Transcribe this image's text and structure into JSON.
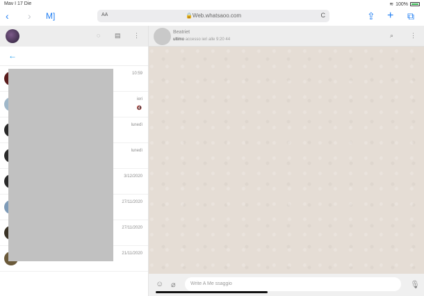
{
  "status_bar": {
    "time": "Mav I 17 Die",
    "battery_text": "100%",
    "wifi_icon": "wifi-icon"
  },
  "browser": {
    "back_icon": "‹",
    "forward_icon": "›",
    "bookmarks_icon": "M]",
    "aa_label": "AA",
    "url": "Web.whatsaoo.com",
    "reload_icon": "C",
    "share_icon": "⇪",
    "new_tab_icon": "+",
    "tabs_icon": "⧉"
  },
  "sidebar": {
    "back_arrow": "←",
    "chats": [
      {
        "time": "10:59",
        "snippet": "",
        "mute": ""
      },
      {
        "time": "ieri",
        "snippet": "",
        "mute": "🔇"
      },
      {
        "time": "lunedì",
        "snippet": "",
        "mute": ""
      },
      {
        "time": "lunedì",
        "snippet": "",
        "mute": ""
      },
      {
        "time": "3/12/2020",
        "snippet": "",
        "mute": ""
      },
      {
        "time": "27/11/2020",
        "snippet": "",
        "mute": ""
      },
      {
        "time": "27/11/2020",
        "snippet": "",
        "mute": ""
      },
      {
        "time": "21/11/2020",
        "snippet": "",
        "mute": ""
      }
    ]
  },
  "conversation": {
    "contact_name": "Beatriet",
    "status_prefix": "ultimo",
    "status_text": "accesso ieri alle 9:20 44",
    "composer_placeholder": "Write A Me ssaggio"
  }
}
